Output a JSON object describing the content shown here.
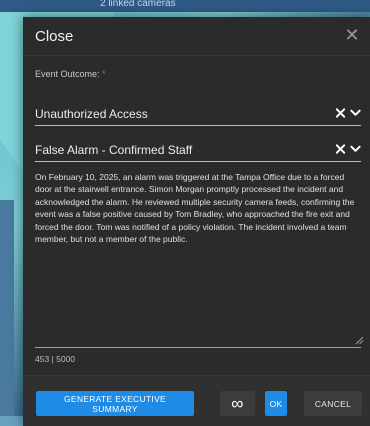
{
  "background": {
    "linked_cameras": "2 linked cameras"
  },
  "dialog": {
    "title": "Close",
    "close_glyph": "✕",
    "event_outcome_label": "Event Outcome:",
    "required_marker": "*",
    "outcome_value": "Unauthorized Access",
    "sub_outcome_value": "False Alarm - Confirmed Staff",
    "notes": "On February 10, 2025, an alarm was triggered at the Tampa Office due to a forced door at the stairwell entrance. Simon Morgan promptly processed the incident and acknowledged the alarm. He reviewed multiple security camera feeds, confirming the event was a false positive caused by Tom Bradley, who approached the fire exit and forced the door. Tom was notified of a policy violation. The incident involved a team member, but not a member of the public.",
    "counter": "453 | 5000"
  },
  "footer": {
    "exec_summary_label": "GENERATE EXECUTIVE SUMMARY",
    "infinity_glyph": "∞",
    "ok_label": "OK",
    "cancel_label": "CANCEL"
  },
  "colors": {
    "accent": "#1e8be6",
    "dialog_bg": "#2b2b2b",
    "required": "#e05050"
  }
}
